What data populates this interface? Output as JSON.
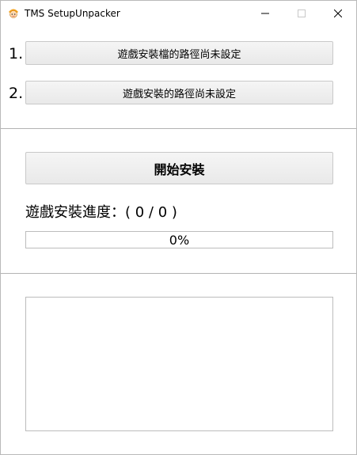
{
  "window": {
    "title": "TMS SetupUnpacker",
    "icon": "app-character-icon",
    "controls": {
      "minimize": "minimize-icon",
      "maximize": "maximize-icon",
      "close": "close-icon"
    }
  },
  "steps": [
    {
      "number": "1.",
      "button_label": "遊戲安裝檔的路徑尚未設定"
    },
    {
      "number": "2.",
      "button_label": "遊戲安裝的路徑尚未設定"
    }
  ],
  "install": {
    "start_label": "開始安裝",
    "progress_label": "遊戲安裝進度：( 0 / 0 )",
    "progress_text": "0%",
    "progress_fraction": 0
  },
  "log": {
    "content": ""
  },
  "colors": {
    "progress_fill": "#06b025",
    "border": "#bcbcbc",
    "divider": "#b3b3b3"
  }
}
